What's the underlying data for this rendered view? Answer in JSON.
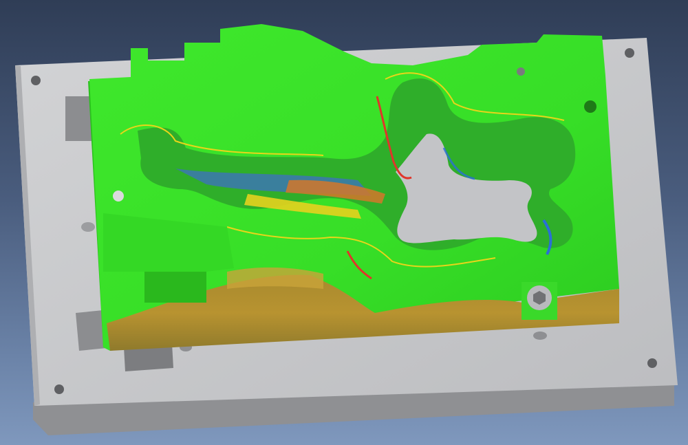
{
  "viewport": {
    "background_top": "#2f3d56",
    "background_bottom": "#7f98bd"
  },
  "model": {
    "base_plate_color": "#c9cacc",
    "base_plate_side_color": "#9a9b9e",
    "deviation_nominal_color": "#39e62a",
    "deviation_plus_color": "#e8d51a",
    "deviation_max_color": "#e0352a",
    "deviation_minus_color": "#2a6fd6",
    "floor_color": "#b38a2a"
  }
}
